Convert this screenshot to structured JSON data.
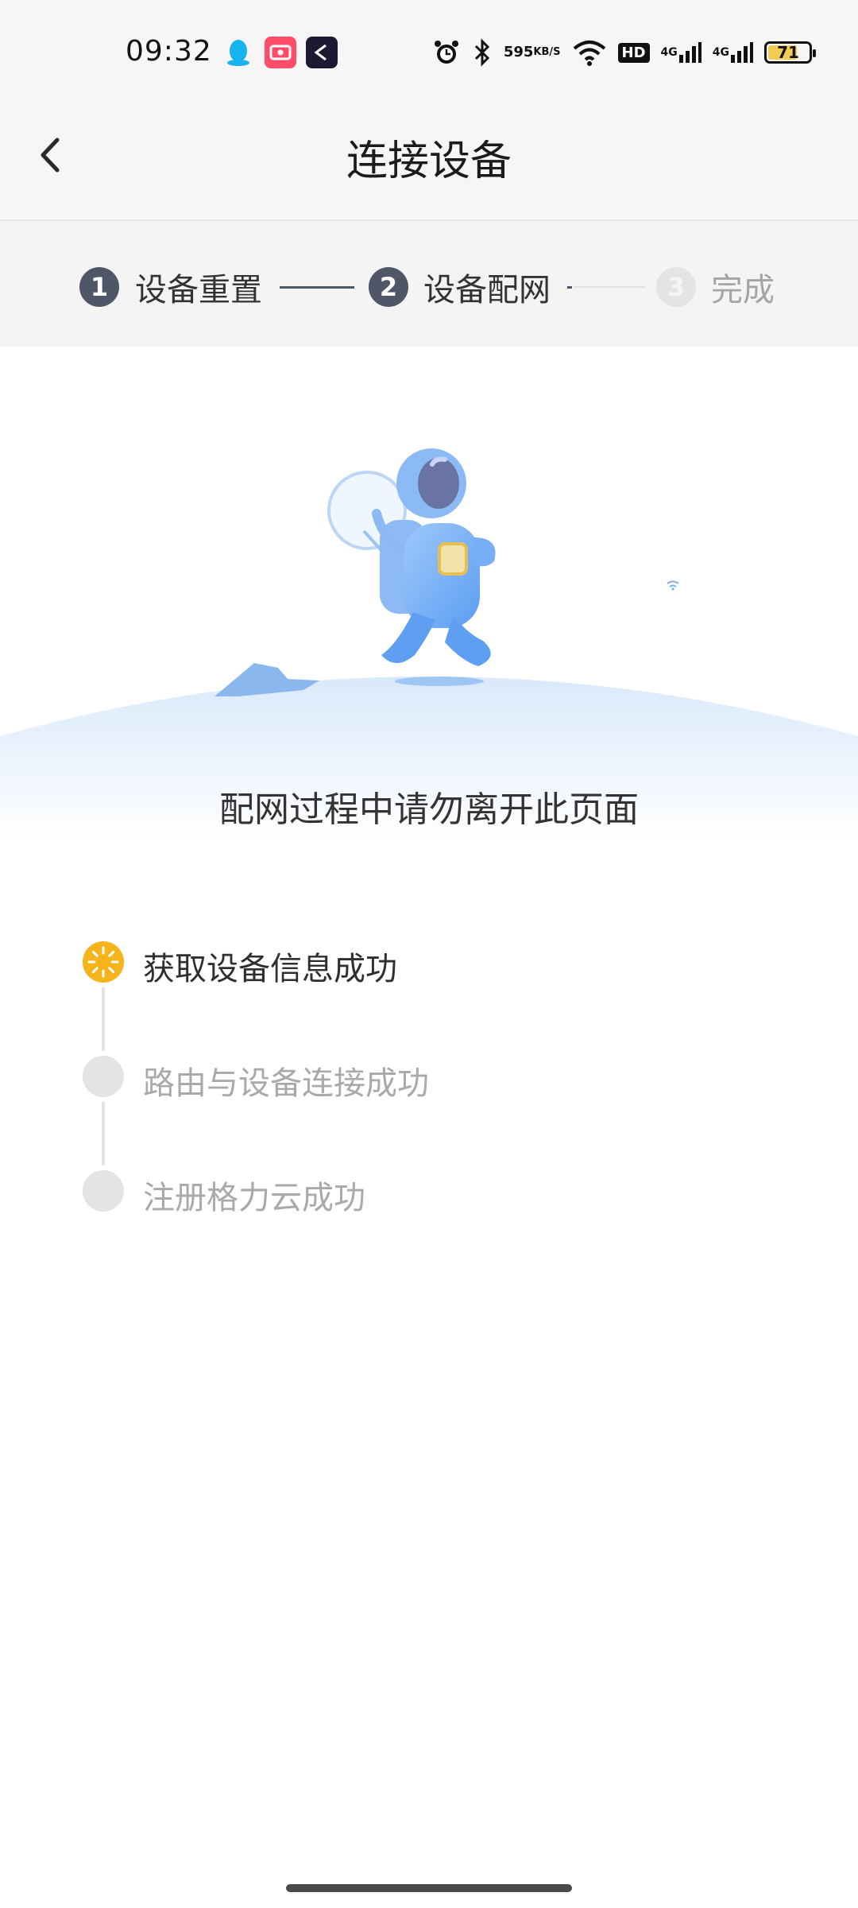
{
  "status_bar": {
    "time": "09:32",
    "net_speed_value": "595",
    "net_speed_unit": "KB/S",
    "hd_label": "HD",
    "signal1_label": "4G",
    "signal2_label": "4G",
    "battery_level": "71",
    "battery_color": "#f2cb51",
    "icons": [
      "qq-icon",
      "screen-record-icon",
      "capcut-icon",
      "alarm-icon",
      "bluetooth-icon",
      "wifi-icon",
      "hd-icon",
      "signal-icon",
      "signal-icon",
      "battery-icon"
    ]
  },
  "header": {
    "title": "连接设备",
    "back_icon": "chevron-left-icon"
  },
  "steps": [
    {
      "number": "1",
      "label": "设备重置",
      "state": "done"
    },
    {
      "number": "2",
      "label": "设备配网",
      "state": "active"
    },
    {
      "number": "3",
      "label": "完成",
      "state": "pending"
    }
  ],
  "hero": {
    "illustration": "astronaut-illustration"
  },
  "hint": "配网过程中请勿离开此页面",
  "progress_items": [
    {
      "label": "获取设备信息成功",
      "state": "loading"
    },
    {
      "label": "路由与设备连接成功",
      "state": "pending"
    },
    {
      "label": "注册格力云成功",
      "state": "pending"
    }
  ],
  "colors": {
    "step_active": "#4e5667",
    "step_pending": "#e1e1e3",
    "accent_loading": "#f5b31c",
    "pending_text": "#a9a9a9"
  }
}
